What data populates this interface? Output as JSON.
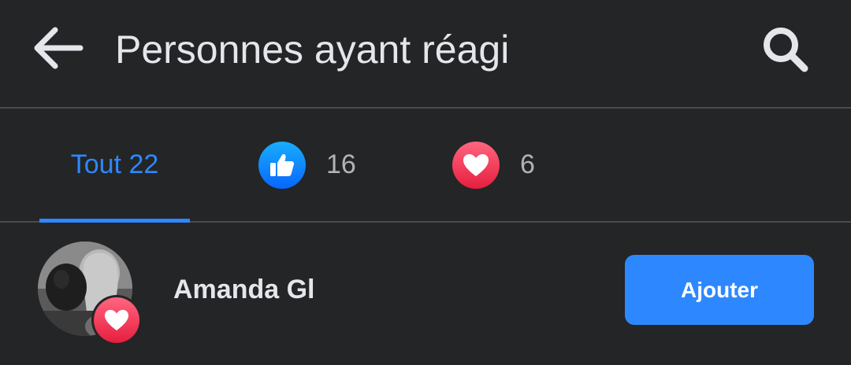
{
  "header": {
    "title": "Personnes ayant réagi",
    "back_icon": "arrow-left-icon",
    "search_icon": "search-icon"
  },
  "tabs": [
    {
      "id": "all",
      "label": "Tout 22",
      "active": true
    },
    {
      "id": "like",
      "icon": "like-icon",
      "count": "16",
      "active": false
    },
    {
      "id": "love",
      "icon": "love-icon",
      "count": "6",
      "active": false
    }
  ],
  "people": [
    {
      "name": "Amanda Gl",
      "reaction": "love-icon",
      "button_label": "Ajouter"
    }
  ],
  "colors": {
    "background": "#242526",
    "accent": "#2d88ff",
    "text_primary": "#e4e6eb",
    "text_secondary": "#b0b3b8",
    "divider": "#4a4b4d",
    "like": "#1877f2",
    "love": "#f33e58"
  }
}
